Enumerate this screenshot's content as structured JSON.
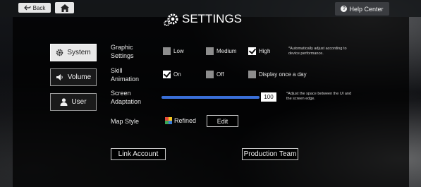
{
  "header": {
    "back_label": "Back",
    "title": "SETTINGS",
    "help_label": "Help Center"
  },
  "sidebar": {
    "items": [
      {
        "label": "System",
        "icon": "gear-icon",
        "active": true
      },
      {
        "label": "Volume",
        "icon": "speaker-icon",
        "active": false
      },
      {
        "label": "User",
        "icon": "user-icon",
        "active": false
      }
    ]
  },
  "settings": {
    "graphic": {
      "label_line1": "Graphic",
      "label_line2": "Settings",
      "options": [
        {
          "label": "Low",
          "checked": false
        },
        {
          "label": "Medium",
          "checked": false
        },
        {
          "label": "High",
          "checked": true
        }
      ],
      "note_line1": "*Automatically adjust according to",
      "note_line2": "device performance."
    },
    "skill": {
      "label_line1": "Skill",
      "label_line2": "Animation",
      "options": [
        {
          "label": "On",
          "checked": true
        },
        {
          "label": "Off",
          "checked": false
        },
        {
          "label": "Display once a day",
          "checked": false
        }
      ]
    },
    "screen": {
      "label_line1": "Screen",
      "label_line2": "Adaptation",
      "value": "100",
      "note_line1": "*Adjust the space between the UI and",
      "note_line2": "the screen edge."
    },
    "map": {
      "label": "Map Style",
      "value": "Refined",
      "edit_label": "Edit"
    }
  },
  "footer": {
    "link_account_label": "Link Account",
    "production_team_label": "Production Team"
  },
  "colors": {
    "accent": "#3a6fd8"
  }
}
